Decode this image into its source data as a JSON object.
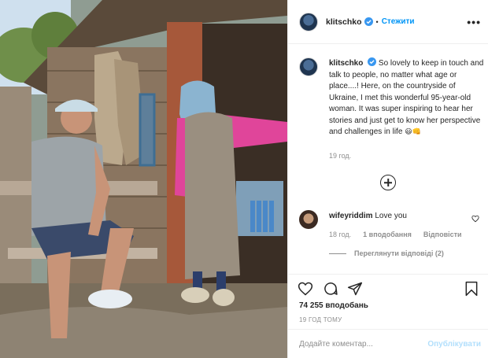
{
  "photo": {
    "alt": "Man in cap sitting on a bench talking with an elderly woman in a headscarf by a wooden house"
  },
  "header": {
    "username": "klitschko",
    "dot": "•",
    "follow_label": "Стежити",
    "more_label": "•••"
  },
  "caption": {
    "username": "klitschko",
    "text": "So lovely to keep in touch and talk to people, no matter what age or place....! Here, on the countryside of Ukraine, I met this wonderful 95-year-old woman. It was super inspiring to hear her stories and just get to know her perspective and challenges in life",
    "emojis": "😃👊",
    "time": "19 год."
  },
  "comment": {
    "username": "wifeyriddim",
    "text": "Love you",
    "time": "18 год.",
    "likes": "1 вподобання",
    "reply_label": "Відповісти",
    "view_replies": "Переглянути відповіді (2)"
  },
  "actions": {
    "likes": "74 255 вподобань",
    "time": "19 ГОД ТОМУ"
  },
  "add_comment": {
    "placeholder": "Додайте коментар...",
    "publish_label": "Опублікувати"
  },
  "colors": {
    "link": "#0095f6",
    "verified": "#3897f0",
    "publish_disabled": "#b2dffc",
    "muted": "#8e8e8e"
  }
}
